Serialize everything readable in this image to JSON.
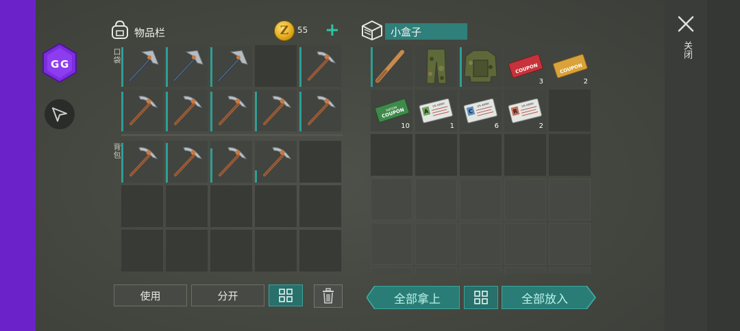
{
  "inventory": {
    "title": "物品栏",
    "coins": "55",
    "pocket_label": "口袋",
    "backpack_label": "背包"
  },
  "container": {
    "name": "小盒子"
  },
  "buttons": {
    "use": "使用",
    "split": "分开",
    "take_all": "全部拿上",
    "put_all": "全部放入",
    "close": "关闭"
  },
  "container_items": [
    {
      "name": "baseball-bat",
      "qty": ""
    },
    {
      "name": "camo-pants",
      "qty": ""
    },
    {
      "name": "camo-jacket",
      "qty": ""
    },
    {
      "name": "red-coupon",
      "qty": "3"
    },
    {
      "name": "gold-coupon",
      "qty": "2"
    },
    {
      "name": "ration-coupon",
      "qty": "10"
    },
    {
      "name": "army-card-a",
      "qty": "1"
    },
    {
      "name": "army-card-c",
      "qty": "6"
    },
    {
      "name": "army-card-r",
      "qty": "2"
    }
  ],
  "coupon_texts": {
    "coupon": "COUPON",
    "ration": "RATION",
    "army": "US ARMY",
    "a": "A",
    "c": "C",
    "r": "R"
  },
  "colors": {
    "accent": "#2e9f95",
    "gg_purple": "#6b23c9"
  }
}
